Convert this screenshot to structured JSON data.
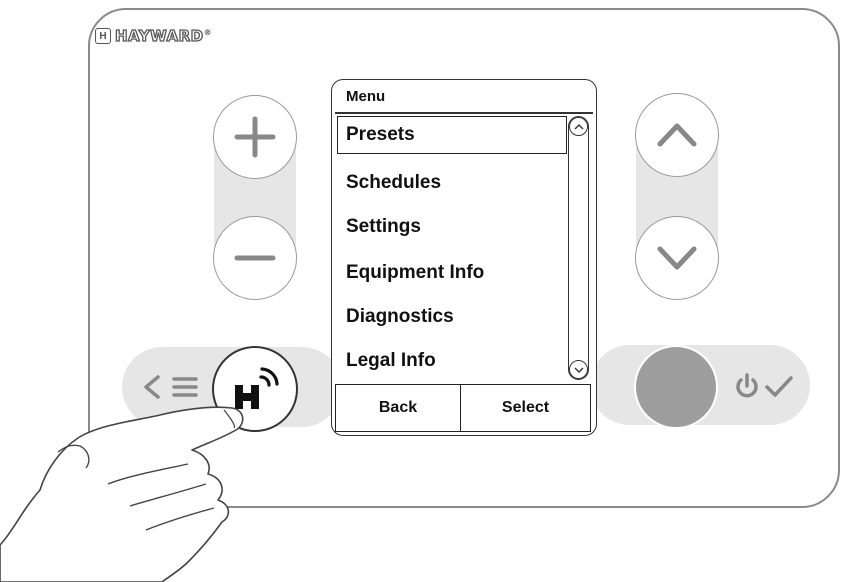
{
  "brand": {
    "name": "HAYWARD",
    "mark": "®",
    "logo_letter": "H"
  },
  "screen": {
    "title": "Menu",
    "items": [
      "Presets",
      "Schedules",
      "Settings",
      "Equipment Info",
      "Diagnostics",
      "Legal Info"
    ],
    "selected_index": 0,
    "softkeys": {
      "back": "Back",
      "select": "Select"
    }
  },
  "controls": {
    "left_nav_symbols": "< ☰",
    "hotkey_letter": "H"
  },
  "colors": {
    "accent_gray": "#9e9e9e",
    "track": "#e6e6e6",
    "border": "#8a8a8a"
  }
}
